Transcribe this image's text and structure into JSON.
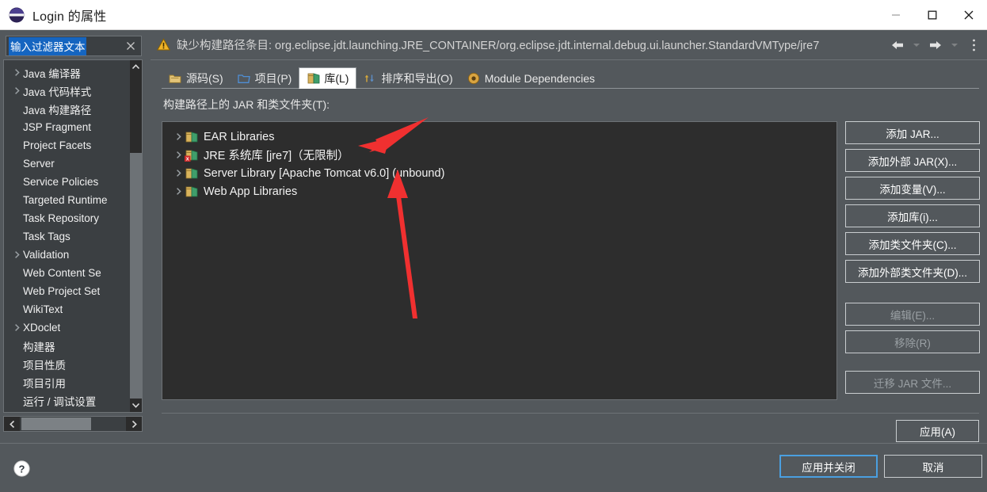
{
  "window": {
    "title": "Login 的属性",
    "logo_icon": "eclipse-logo",
    "minimize_label": "—",
    "maximize_label": "□",
    "close_label": "✕"
  },
  "sidebar": {
    "filter": {
      "value": "输入过滤器文本",
      "placeholder": "输入过滤器文本",
      "clear_icon": "clear-icon"
    },
    "items": [
      {
        "label": "Java 编译器",
        "expandable": true
      },
      {
        "label": "Java 代码样式",
        "expandable": true
      },
      {
        "label": "Java 构建路径",
        "expandable": false
      },
      {
        "label": "JSP Fragment",
        "expandable": false
      },
      {
        "label": "Project Facets",
        "expandable": false
      },
      {
        "label": "Server",
        "expandable": false
      },
      {
        "label": "Service Policies",
        "expandable": false
      },
      {
        "label": "Targeted Runtime",
        "expandable": false
      },
      {
        "label": "Task Repository",
        "expandable": false
      },
      {
        "label": "Task Tags",
        "expandable": false
      },
      {
        "label": "Validation",
        "expandable": true
      },
      {
        "label": "Web Content Se",
        "expandable": false
      },
      {
        "label": "Web Project Set",
        "expandable": false
      },
      {
        "label": "WikiText",
        "expandable": false
      },
      {
        "label": "XDoclet",
        "expandable": true
      },
      {
        "label": "构建器",
        "expandable": false
      },
      {
        "label": "项目性质",
        "expandable": false
      },
      {
        "label": "项目引用",
        "expandable": false
      },
      {
        "label": "运行 / 调试设置",
        "expandable": false
      }
    ],
    "scroll_up_icon": "chevron-up-icon",
    "scroll_down_icon": "chevron-down-icon",
    "scroll_left_icon": "chevron-left-icon",
    "scroll_right_icon": "chevron-right-icon"
  },
  "message_bar": {
    "icon": "warning-icon",
    "text": "缺少构建路径条目: org.eclipse.jdt.launching.JRE_CONTAINER/org.eclipse.jdt.internal.debug.ui.launcher.StandardVMType/jre7",
    "nav": {
      "back_icon": "arrow-left-icon",
      "back_menu_icon": "chevron-down-icon",
      "forward_icon": "arrow-right-icon",
      "forward_menu_icon": "chevron-down-icon",
      "overflow_icon": "vertical-dots-icon"
    }
  },
  "tabs": [
    {
      "label": "源码(S)",
      "icon": "source-folder-icon",
      "active": false
    },
    {
      "label": "项目(P)",
      "icon": "project-folder-icon",
      "active": false
    },
    {
      "label": "库(L)",
      "icon": "library-icon",
      "active": true
    },
    {
      "label": "排序和导出(O)",
      "icon": "order-export-icon",
      "active": false
    },
    {
      "label": "Module Dependencies",
      "icon": "module-icon",
      "active": false
    }
  ],
  "main": {
    "tree_label": "构建路径上的 JAR 和类文件夹(T):",
    "entries": [
      {
        "label": "EAR Libraries",
        "icon": "library-icon",
        "expandable": true,
        "error": false
      },
      {
        "label": "JRE 系统库 [jre7]（无限制）",
        "icon": "library-error-icon",
        "expandable": true,
        "error": true
      },
      {
        "label": "Server Library [Apache Tomcat v6.0] (unbound)",
        "icon": "library-icon",
        "expandable": true,
        "error": false
      },
      {
        "label": "Web App Libraries",
        "icon": "library-icon",
        "expandable": true,
        "error": false
      }
    ],
    "buttons": [
      {
        "label": "添加 JAR...",
        "enabled": true
      },
      {
        "label": "添加外部 JAR(X)...",
        "enabled": true
      },
      {
        "label": "添加变量(V)...",
        "enabled": true
      },
      {
        "label": "添加库(i)...",
        "enabled": true
      },
      {
        "label": "添加类文件夹(C)...",
        "enabled": true
      },
      {
        "label": "添加外部类文件夹(D)...",
        "enabled": true
      },
      {
        "label": "编辑(E)...",
        "enabled": false
      },
      {
        "label": "移除(R)",
        "enabled": false
      },
      {
        "label": "迁移 JAR 文件...",
        "enabled": false
      }
    ],
    "apply_label": "应用(A)"
  },
  "footer": {
    "help_icon": "help-icon",
    "apply_close_label": "应用并关闭",
    "cancel_label": "取消"
  },
  "annotations": {
    "arrow_1_name": "red-arrow-to-jre-entry",
    "arrow_2_name": "red-arrow-to-server-library-entry",
    "color": "#f03030"
  },
  "colors": {
    "dialog_bg": "#53585c",
    "tree_bg": "#2d2d2d",
    "sidebar_tree_bg": "#3b3f42",
    "titlebar_bg": "#ffffff",
    "selection_blue": "#1565c0",
    "focus_blue": "#4a9fe0",
    "annotation_red": "#f03030"
  }
}
